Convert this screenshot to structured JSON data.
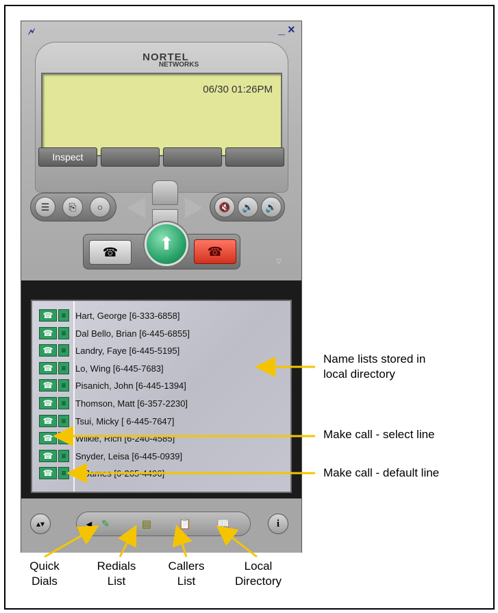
{
  "window": {
    "logo_icon": "bolt-logo-icon",
    "minimize_label": "_",
    "close_label": "×"
  },
  "brand": {
    "line1": "NORTEL",
    "line2": "NETWORKS"
  },
  "lcd": {
    "datetime": "06/30 01:26PM"
  },
  "softkeys": [
    "Inspect",
    "",
    "",
    ""
  ],
  "directory": {
    "entries": [
      "Hart, George [6-333-6858]",
      "Dal Bello, Brian [6-445-6855]",
      "Landry, Faye [6-445-5195]",
      "Lo, Wing [6-445-7683]",
      "Pisanich, John [6-445-1394]",
      "Thomson, Matt [6-357-2230]",
      "Tsui, Micky [ 6-445-7647]",
      "Wilkie, Rich [6-240-4585]",
      "Snyder, Leisa [6-445-0939]",
      "u, James [6-265-4496]"
    ]
  },
  "annotations": {
    "name_lists": "Name lists stored in\nlocal directory",
    "make_call_select": "Make call - select line",
    "make_call_default": "Make call - default line"
  },
  "captions": {
    "quick_dials": "Quick\nDials",
    "redials_list": "Redials\nList",
    "callers_list": "Callers\nList",
    "local_directory": "Local\nDirectory"
  },
  "colors": {
    "arrow": "#f5c400",
    "lcd": "#e1e699",
    "answer": "#2aa46a",
    "release": "#d2321e"
  }
}
